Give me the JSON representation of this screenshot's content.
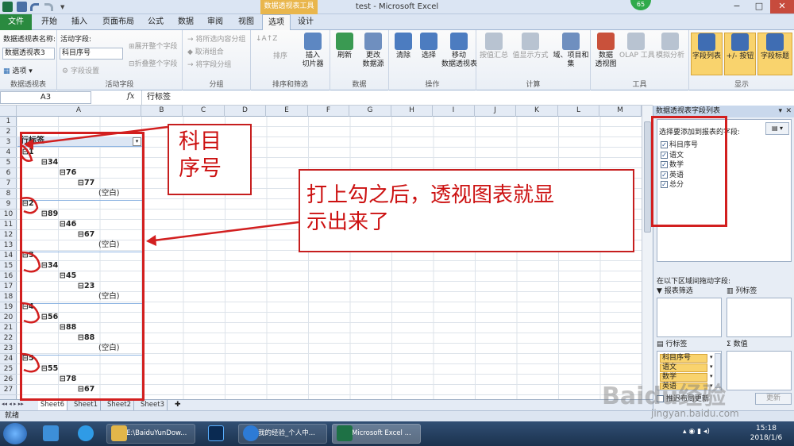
{
  "window": {
    "title": "test  -  Microsoft Excel",
    "contextual_tab_group": "数据透视表工具",
    "controls": [
      "−",
      "□",
      "✕"
    ],
    "badge": "65"
  },
  "tabs": [
    "文件",
    "开始",
    "插入",
    "页面布局",
    "公式",
    "数据",
    "审阅",
    "视图",
    "选项",
    "设计"
  ],
  "ribbon": {
    "pivot_name_label": "数据透视表名称:",
    "pivot_name_value": "数据透视表3",
    "options_label": "选项",
    "active_field_label": "活动字段:",
    "active_field_value": "科目序号",
    "field_settings": "字段设置",
    "expand_field": "展开整个字段",
    "collapse_field": "折叠整个字段",
    "group_selection": "将所选内容分组",
    "ungroup": "取消组合",
    "group_field": "将字段分组",
    "sort": "排序",
    "insert_slicer": "插入\n切片器",
    "refresh": "刷新",
    "change_source": "更改\n数据源",
    "clear": "清除",
    "select": "选择",
    "move_pivot": "移动\n数据透视表",
    "summarize": "按值汇总",
    "show_values": "值显示方式",
    "fields_items": "域、项目和\n集",
    "pivot_chart": "数据\n透视图",
    "olap": "OLAP 工具",
    "whatif": "模拟分析",
    "field_list": "字段列表",
    "plus_minus": "+/- 按钮",
    "field_headers": "字段标题",
    "groups": {
      "pivot": "数据透视表",
      "active_field": "活动字段",
      "group": "分组",
      "sort_filter": "排序和筛选",
      "data": "数据",
      "actions": "操作",
      "calculations": "计算",
      "tools": "工具",
      "show": "显示"
    }
  },
  "formula_bar": {
    "name_box": "A3",
    "fx": "fx",
    "content": "行标签"
  },
  "columns": [
    "A",
    "B",
    "C",
    "D",
    "E",
    "F",
    "G",
    "H",
    "I",
    "J",
    "K",
    "L",
    "M"
  ],
  "rows": [
    "1",
    "2",
    "3",
    "4",
    "5",
    "6",
    "7",
    "8",
    "9",
    "10",
    "11",
    "12",
    "13",
    "14",
    "15",
    "16",
    "17",
    "18",
    "19",
    "20",
    "21",
    "22",
    "23",
    "24",
    "25",
    "26",
    "27"
  ],
  "pivot": {
    "header": "行标签",
    "cells": [
      {
        "text": "⊟1",
        "level": 0
      },
      {
        "text": "⊟34",
        "level": 1
      },
      {
        "text": "⊟76",
        "level": 2
      },
      {
        "text": "⊟77",
        "level": 3
      },
      {
        "text": "(空白)",
        "level": 4
      },
      {
        "text": "⊟2",
        "level": 0
      },
      {
        "text": "⊟89",
        "level": 1
      },
      {
        "text": "⊟46",
        "level": 2
      },
      {
        "text": "⊟67",
        "level": 3
      },
      {
        "text": "(空白)",
        "level": 4
      },
      {
        "text": "⊟3",
        "level": 0
      },
      {
        "text": "⊟34",
        "level": 1
      },
      {
        "text": "⊟45",
        "level": 2
      },
      {
        "text": "⊟23",
        "level": 3
      },
      {
        "text": "(空白)",
        "level": 4
      },
      {
        "text": "⊟4",
        "level": 0
      },
      {
        "text": "⊟56",
        "level": 1
      },
      {
        "text": "⊟88",
        "level": 2
      },
      {
        "text": "⊟88",
        "level": 3
      },
      {
        "text": "(空白)",
        "level": 4
      },
      {
        "text": "⊟5",
        "level": 0
      },
      {
        "text": "⊟55",
        "level": 1
      },
      {
        "text": "⊟78",
        "level": 2
      },
      {
        "text": "⊟67",
        "level": 3
      }
    ]
  },
  "sheets": [
    "Sheet6",
    "Sheet1",
    "Sheet2",
    "Sheet3"
  ],
  "status": "就绪",
  "field_panel": {
    "title": "数据透视表字段列表",
    "choose_label": "选择要添加到报表的字段:",
    "fields": [
      "科目序号",
      "语文",
      "数学",
      "英语",
      "总分"
    ],
    "drag_label": "在以下区域间拖动字段:",
    "report_filter": "报表筛选",
    "column_labels": "列标签",
    "row_labels": "行标签",
    "values": "数值",
    "row_items": [
      "科目序号",
      "语文",
      "数学",
      "英语"
    ],
    "defer_update": "推迟布局更新",
    "update": "更新"
  },
  "annotations": {
    "callout1": "科目\n序号",
    "callout2": "打上勾之后，透视图表就显\n示出来了"
  },
  "taskbar": {
    "items": [
      "E:\\BaiduYunDow...",
      "我的经验_个人中...",
      "Microsoft Excel ..."
    ],
    "time": "15:18",
    "date": "2018/1/6"
  },
  "watermark": "Baidu经验",
  "watermark_url": "jingyan.baidu.com"
}
